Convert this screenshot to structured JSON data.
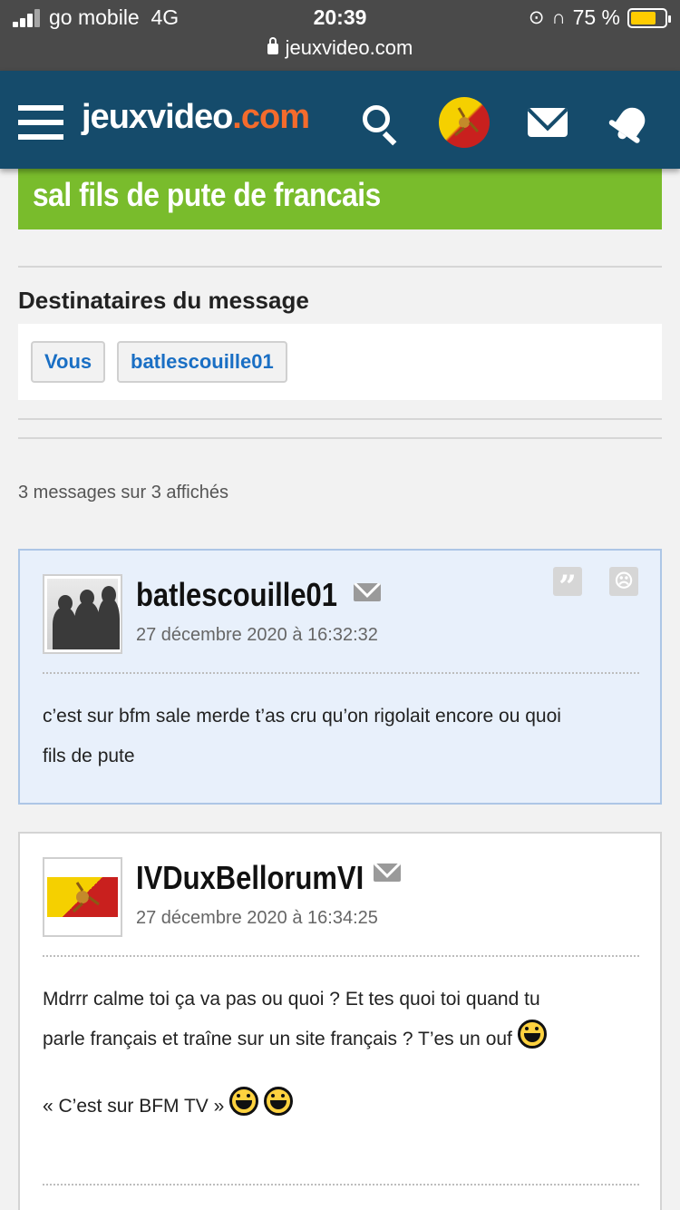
{
  "status_bar": {
    "carrier": "go mobile",
    "network": "4G",
    "time": "20:39",
    "battery": "75 %",
    "battery_level": 0.75,
    "url": "jeuxvideo.com"
  },
  "header": {
    "logo_main": "jeuxvideo",
    "logo_dot": ".com"
  },
  "thread": {
    "title": "sal fils de pute de francais"
  },
  "recipients": {
    "title": "Destinataires du message",
    "items": [
      "Vous",
      "batlescouille01"
    ]
  },
  "messages_count": "3 messages sur 3 affichés",
  "messages": [
    {
      "author": "batlescouille01",
      "date": "27 décembre 2020 à 16:32:32",
      "lines": [
        "c’est sur bfm sale merde t’as cru qu’on rigolait encore ou quoi",
        "fils de pute"
      ]
    },
    {
      "author": "IVDuxBellorumVI",
      "date": "27 décembre 2020 à 16:34:25",
      "line1": "Mdrrr calme toi ça va pas ou quoi ? Et tes quoi toi quand tu",
      "line2": "parle français et traîne sur un site français ? T’es un ouf",
      "line3": "« C’est sur BFM TV »"
    }
  ],
  "colors": {
    "header_bg": "#154b6b",
    "title_bg": "#79bc2c",
    "logo_accent": "#f46b2c",
    "own_msg_bg": "#e8f0fb",
    "link": "#1a6fc4"
  }
}
